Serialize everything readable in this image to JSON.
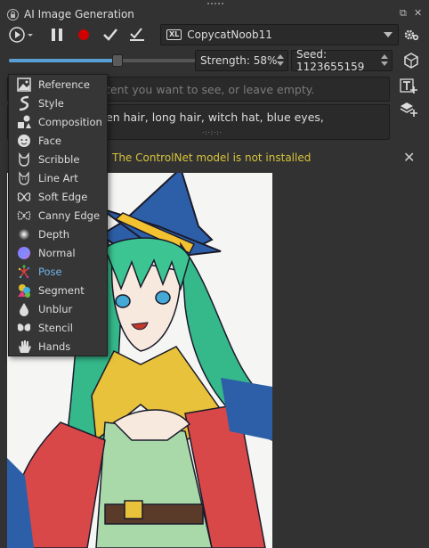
{
  "window": {
    "title": "AI Image Generation"
  },
  "toolbar": {
    "model": "CopycatNoob11",
    "model_badge": "XL",
    "strength": "Strength: 58%",
    "strength_value": 0.58,
    "seed": "Seed: 1123655159"
  },
  "prompts": {
    "negative_placeholder": "tent you want to see, or leave empty.",
    "positive_text": "en hair, long hair, witch hat, blue eyes,",
    "resize_handle": "·:·:·:·"
  },
  "warning": "The ControlNet model is not installed",
  "menu": {
    "items": [
      {
        "label": "Reference",
        "icon": "reference-icon"
      },
      {
        "label": "Style",
        "icon": "style-icon"
      },
      {
        "label": "Composition",
        "icon": "composition-icon"
      },
      {
        "label": "Face",
        "icon": "face-icon"
      },
      {
        "label": "Scribble",
        "icon": "scribble-icon"
      },
      {
        "label": "Line Art",
        "icon": "line-art-icon"
      },
      {
        "label": "Soft Edge",
        "icon": "soft-edge-icon"
      },
      {
        "label": "Canny Edge",
        "icon": "canny-edge-icon"
      },
      {
        "label": "Depth",
        "icon": "depth-icon"
      },
      {
        "label": "Normal",
        "icon": "normal-icon"
      },
      {
        "label": "Pose",
        "icon": "pose-icon",
        "highlighted": true
      },
      {
        "label": "Segment",
        "icon": "segment-icon"
      },
      {
        "label": "Unblur",
        "icon": "unblur-icon"
      },
      {
        "label": "Stencil",
        "icon": "stencil-icon"
      },
      {
        "label": "Hands",
        "icon": "hands-icon"
      }
    ]
  },
  "colors": {
    "accent": "#5a9fd4",
    "warning": "#d6c33a",
    "record": "#d00000",
    "highlight": "#6fb4e8"
  }
}
